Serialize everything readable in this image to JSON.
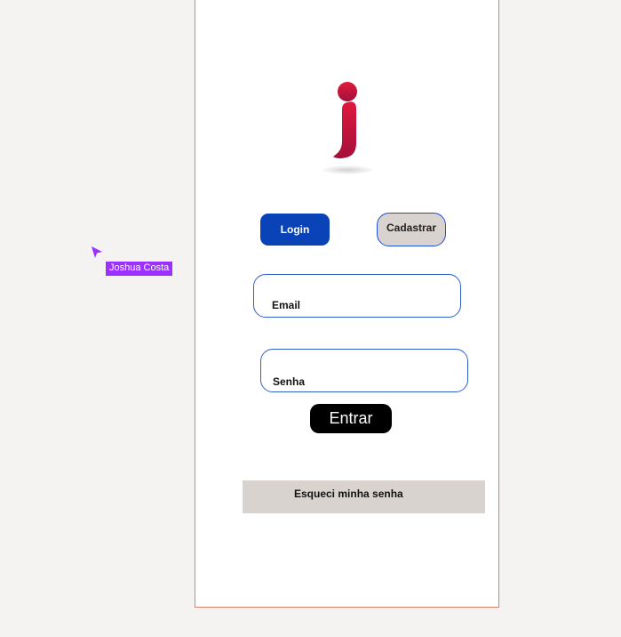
{
  "tabs": {
    "login_label": "Login",
    "signup_label": "Cadastrar"
  },
  "form": {
    "email_label": "Email",
    "password_label": "Senha",
    "submit_label": "Entrar"
  },
  "links": {
    "forgot_password": "Esqueci minha senha"
  },
  "collaborator": {
    "name": "Joshua Costa",
    "color": "#9b30ff"
  },
  "colors": {
    "primary": "#0a43b8",
    "logo_top": "#e0193e",
    "logo_bottom": "#a3103a",
    "secondary_bg": "#d8d3ce",
    "frame_border": "#d9826d"
  },
  "logo": {
    "icon": "letter-j-logo-icon"
  }
}
